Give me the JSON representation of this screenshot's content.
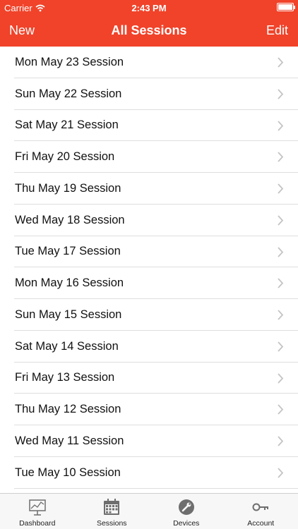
{
  "status_bar": {
    "carrier": "Carrier",
    "time": "2:43 PM"
  },
  "nav": {
    "left_label": "New",
    "title": "All Sessions",
    "right_label": "Edit"
  },
  "sessions": [
    "Mon May 23 Session",
    "Sun May 22 Session",
    "Sat May 21 Session",
    "Fri May 20 Session",
    "Thu May 19 Session",
    "Wed May 18 Session",
    "Tue May 17 Session",
    "Mon May 16 Session",
    "Sun May 15 Session",
    "Sat May 14 Session",
    "Fri May 13 Session",
    "Thu May 12 Session",
    "Wed May 11 Session",
    "Tue May 10 Session"
  ],
  "tabs": [
    {
      "label": "Dashboard",
      "icon": "dashboard-chart-icon"
    },
    {
      "label": "Sessions",
      "icon": "calendar-icon"
    },
    {
      "label": "Devices",
      "icon": "wrench-icon"
    },
    {
      "label": "Account",
      "icon": "key-icon"
    }
  ],
  "colors": {
    "accent": "#f0432a",
    "tab_icon": "#6e6e6e",
    "separator": "#dedede"
  }
}
